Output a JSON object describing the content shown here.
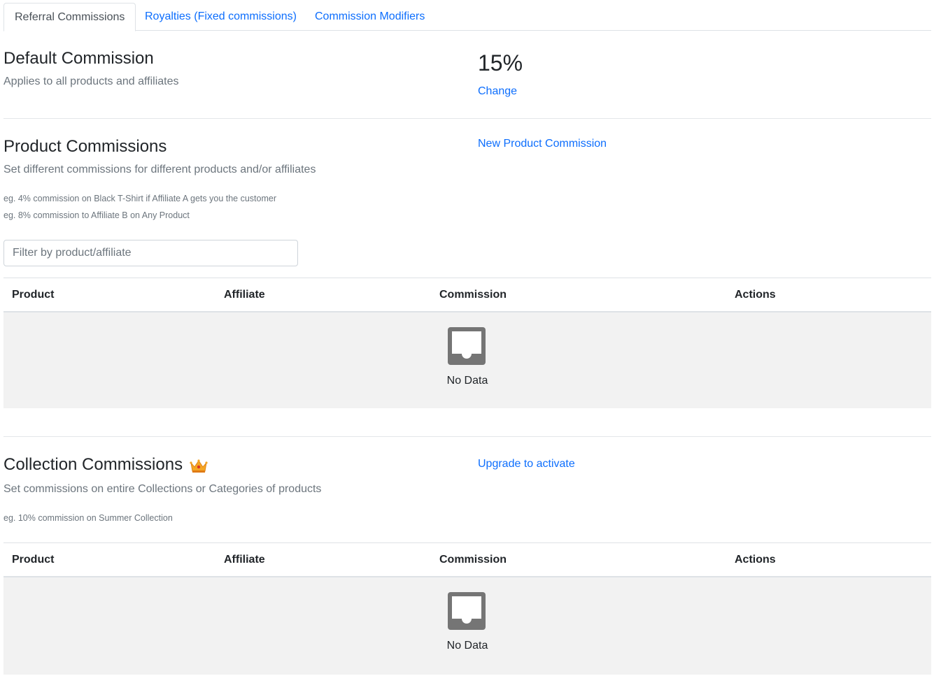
{
  "tabs": [
    {
      "label": "Referral Commissions",
      "active": true
    },
    {
      "label": "Royalties (Fixed commissions)",
      "active": false
    },
    {
      "label": "Commission Modifiers",
      "active": false
    }
  ],
  "default_commission": {
    "title": "Default Commission",
    "subtitle": "Applies to all products and affiliates",
    "value": "15%",
    "change_link": "Change"
  },
  "product_commissions": {
    "title": "Product Commissions",
    "subtitle": "Set different commissions for different products and/or affiliates",
    "examples": [
      "eg. 4% commission on Black T-Shirt if Affiliate A gets you the customer",
      "eg. 8% commission to Affiliate B on Any Product"
    ],
    "new_link": "New Product Commission",
    "filter_placeholder": "Filter by product/affiliate",
    "columns": [
      "Product",
      "Affiliate",
      "Commission",
      "Actions"
    ],
    "empty_text": "No Data"
  },
  "collection_commissions": {
    "title": "Collection Commissions",
    "subtitle": "Set commissions on entire Collections or Categories of products",
    "examples": [
      "eg. 10% commission on Summer Collection"
    ],
    "upgrade_link": "Upgrade to activate",
    "premium_icon": "crown-icon",
    "columns": [
      "Product",
      "Affiliate",
      "Commission",
      "Actions"
    ],
    "empty_text": "No Data"
  },
  "colors": {
    "link": "#0d6efd",
    "muted": "#6c757d",
    "empty_bg": "#f2f2f2",
    "crown": "#f5a623"
  }
}
